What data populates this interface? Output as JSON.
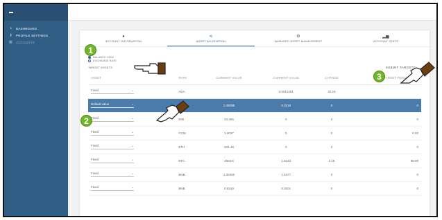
{
  "sidebar": {
    "items": [
      {
        "label": "DASHBOARD",
        "icon": "dashboard-icon"
      },
      {
        "label": "PROFILE SETTINGS",
        "icon": "key-icon"
      },
      {
        "label": "ACCOUNTS",
        "icon": "grid-icon"
      }
    ]
  },
  "tabs": [
    {
      "label": "ACCOUNT INFORMATION",
      "icon": "person-icon"
    },
    {
      "label": "ASSET ALLOCATION",
      "icon": "share-icon"
    },
    {
      "label": "MANAGED ASSET MANAGEMENT",
      "icon": "gear-icon"
    },
    {
      "label": "ACCOUNT STATS",
      "icon": "bar-chart-icon"
    }
  ],
  "radios": [
    {
      "label": "BALANCE VIEW",
      "checked": true
    },
    {
      "label": "EXCHANGE RATE",
      "checked": false
    }
  ],
  "target_label": "TARGET ASSETS",
  "submit_label": "SUBMIT TARGETS",
  "table": {
    "headers": [
      "ASSET",
      "RATE",
      "CURRENT VALUE",
      "CURRENT VALUE",
      "CHANGE",
      "TARGET PERCENTAGE"
    ],
    "rows": [
      {
        "asset": "Fixed",
        "rate": "ADA",
        "v1": "",
        "v2": "0.0014281",
        "change": "22.16",
        "target": "",
        "selected": false
      },
      {
        "asset": "Default value",
        "rate": "ADA",
        "v1": "2.4000B",
        "v2": "0.0215",
        "change": "0",
        "target": "0",
        "selected": true
      },
      {
        "asset": "Fixed",
        "rate": "EMI",
        "v1": "24.366",
        "v2": "0",
        "change": "0",
        "target": "0",
        "selected": false
      },
      {
        "asset": "Fixed",
        "rate": "CCM",
        "v1": "1.2037",
        "v2": "0",
        "change": "0",
        "target": "0.02",
        "selected": false
      },
      {
        "asset": "Fixed",
        "rate": "ETH",
        "v1": "201.18",
        "v2": "0",
        "change": "0",
        "target": "0",
        "selected": false
      },
      {
        "asset": "Fixed",
        "rate": "BTC",
        "v1": "4563.6",
        "v2": "1.5143",
        "change": "2.15",
        "target": "98.98",
        "selected": false
      },
      {
        "asset": "Fixed",
        "rate": "BNB",
        "v1": "1.25200",
        "v2": "1.5477",
        "change": "0",
        "target": "0",
        "selected": false
      },
      {
        "asset": "Fixed",
        "rate": "BNB",
        "v1": "0.8249",
        "v2": "0.0001",
        "change": "0",
        "target": "0",
        "selected": false
      }
    ]
  },
  "badges": [
    "1",
    "2",
    "3"
  ],
  "colors": {
    "sidebar": "#2f5d84",
    "selected_row": "#4a7bab",
    "badge": "#71b62a"
  }
}
